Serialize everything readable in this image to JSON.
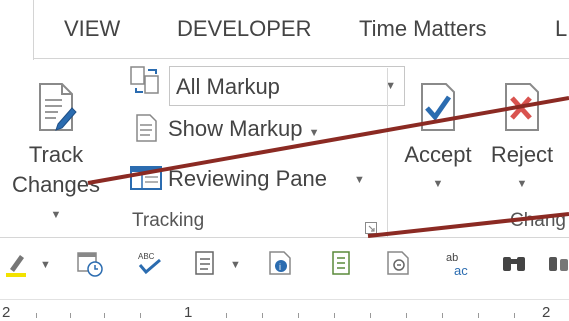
{
  "tabs": {
    "view": "VIEW",
    "developer": "DEVELOPER",
    "time_matters": "Time Matters",
    "partial": "L"
  },
  "tracking": {
    "track_changes_line1": "Track",
    "track_changes_line2": "Changes",
    "markup_combo_value": "All Markup",
    "show_markup": "Show Markup",
    "reviewing_pane": "Reviewing Pane",
    "group_label": "Tracking"
  },
  "changes": {
    "accept": "Accept",
    "reject": "Reject",
    "group_label": "Chang"
  },
  "ruler": {
    "left": "2",
    "one": "1",
    "two": "2"
  },
  "colors": {
    "accent_blue": "#2b6cb0",
    "reject_red": "#d9534f",
    "annotation_line": "#8b2a23",
    "highlight_yellow": "#f2e200"
  }
}
